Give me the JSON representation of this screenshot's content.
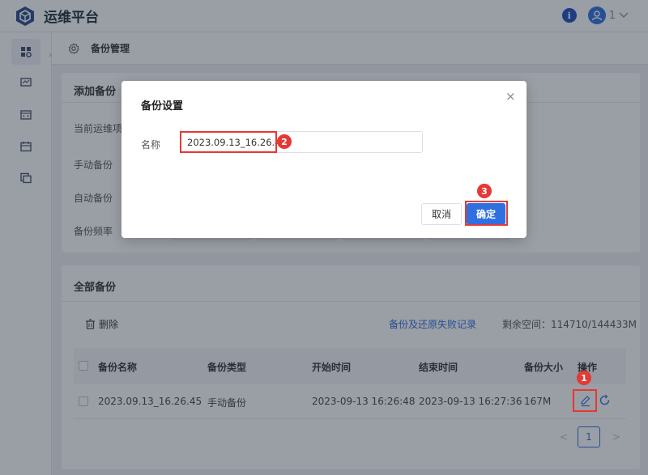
{
  "app": {
    "title": "运维平台",
    "user_number": "1"
  },
  "breadcrumb": {
    "label": "备份管理"
  },
  "sidebar": {
    "items": [
      "dashboard-icon",
      "monitor-icon",
      "code-window-icon",
      "calendar-icon",
      "backup-icon"
    ]
  },
  "add_backup": {
    "title": "添加备份",
    "labels": [
      "当前运维项",
      "手动备份",
      "自动备份",
      "备份频率"
    ]
  },
  "all_backups": {
    "title": "全部备份",
    "delete_label": "删除",
    "fail_record_link": "备份及还原失败记录",
    "space_label": "剩余空间：114710/144433M",
    "columns": [
      "备份名称",
      "备份类型",
      "开始时间",
      "结束时间",
      "备份大小",
      "操作"
    ],
    "rows": [
      {
        "name": "2023.09.13_16.26.45",
        "type": "手动备份",
        "start": "2023-09-13 16:26:48",
        "end": "2023-09-13 16:27:36",
        "size": "167M"
      }
    ],
    "pagination": {
      "prev": "<",
      "page": "1",
      "next": ">"
    }
  },
  "modal": {
    "title": "备份设置",
    "close": "×",
    "name_label": "名称",
    "name_value": "2023.09.13_16.26.45",
    "cancel_label": "取消",
    "ok_label": "确定"
  },
  "steps": [
    "1",
    "2",
    "3"
  ],
  "colors": {
    "accent": "#2f6fe0",
    "highlight": "#e53935"
  }
}
